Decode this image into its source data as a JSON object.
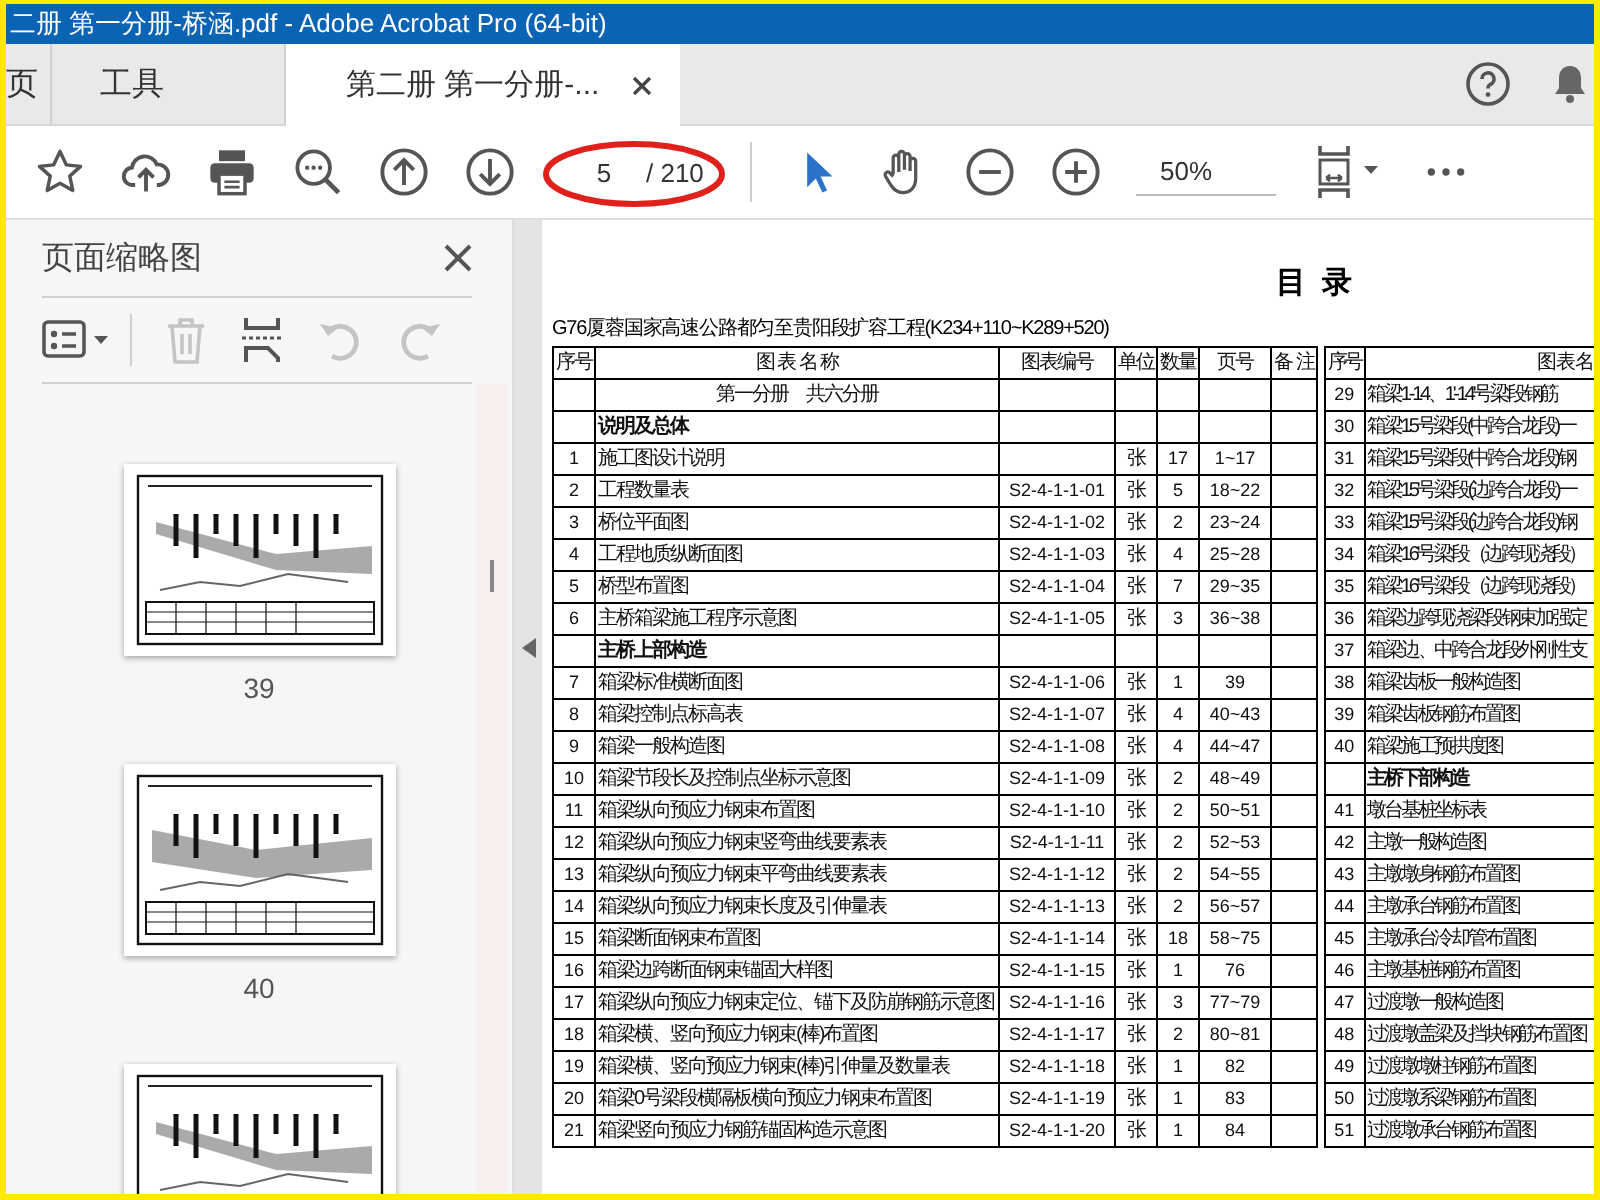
{
  "window": {
    "title": "二册 第一分册-桥涵.pdf - Adobe Acrobat Pro (64-bit)"
  },
  "tabs": [
    {
      "label": "页",
      "selected": false,
      "closable": false
    },
    {
      "label": "工具",
      "selected": false,
      "closable": false
    },
    {
      "label": "第二册 第一分册-...",
      "selected": true,
      "closable": true
    }
  ],
  "toolbar": {
    "page_number": "5",
    "page_count": "/ 210",
    "zoom": "50%"
  },
  "sidebar": {
    "title": "页面缩略图",
    "tools": [
      {
        "kind": "options",
        "disabled": false
      },
      {
        "kind": "delete",
        "disabled": true
      },
      {
        "kind": "insert",
        "disabled": false
      },
      {
        "kind": "rotate-left",
        "disabled": true
      },
      {
        "kind": "rotate-right",
        "disabled": true
      }
    ],
    "thumbnails": [
      {
        "kind": "page",
        "label": "39"
      },
      {
        "kind": "page",
        "label": "40"
      },
      {
        "kind": "page"
      }
    ]
  },
  "document": {
    "title": "目 录",
    "subtitle": "G76厦蓉国家高速公路都匀至贵阳段扩容工程(K234+110~K289+520)",
    "left_table": {
      "columns": [
        "序号",
        "图 表 名 称",
        "图表编号",
        "单位",
        "数量",
        "页号",
        "备 注"
      ],
      "rows": [
        {
          "kind": "volume",
          "name": "第一分册　共六分册"
        },
        {
          "kind": "section",
          "name": "说明及总体"
        },
        {
          "kind": "item",
          "no": "1",
          "name": "施工图设计说明",
          "unit": "张",
          "count": "17",
          "pages": "1~17"
        },
        {
          "kind": "item",
          "no": "2",
          "name": "工程数量表",
          "code": "S2-4-1-1-01",
          "unit": "张",
          "count": "5",
          "pages": "18~22"
        },
        {
          "kind": "item",
          "no": "3",
          "name": "桥位平面图",
          "code": "S2-4-1-1-02",
          "unit": "张",
          "count": "2",
          "pages": "23~24"
        },
        {
          "kind": "item",
          "no": "4",
          "name": "工程地质纵断面图",
          "code": "S2-4-1-1-03",
          "unit": "张",
          "count": "4",
          "pages": "25~28"
        },
        {
          "kind": "item",
          "no": "5",
          "name": "桥型布置图",
          "code": "S2-4-1-1-04",
          "unit": "张",
          "count": "7",
          "pages": "29~35"
        },
        {
          "kind": "item",
          "no": "6",
          "name": "主桥箱梁施工程序示意图",
          "code": "S2-4-1-1-05",
          "unit": "张",
          "count": "3",
          "pages": "36~38"
        },
        {
          "kind": "section",
          "name": "主桥上部构造"
        },
        {
          "kind": "item",
          "no": "7",
          "name": "箱梁标准横断面图",
          "code": "S2-4-1-1-06",
          "unit": "张",
          "count": "1",
          "pages": "39"
        },
        {
          "kind": "item",
          "no": "8",
          "name": "箱梁控制点标高表",
          "code": "S2-4-1-1-07",
          "unit": "张",
          "count": "4",
          "pages": "40~43"
        },
        {
          "kind": "item",
          "no": "9",
          "name": "箱梁一般构造图",
          "code": "S2-4-1-1-08",
          "unit": "张",
          "count": "4",
          "pages": "44~47"
        },
        {
          "kind": "item",
          "no": "10",
          "name": "箱梁节段长及控制点坐标示意图",
          "code": "S2-4-1-1-09",
          "unit": "张",
          "count": "2",
          "pages": "48~49"
        },
        {
          "kind": "item",
          "no": "11",
          "name": "箱梁纵向预应力钢束布置图",
          "code": "S2-4-1-1-10",
          "unit": "张",
          "count": "2",
          "pages": "50~51"
        },
        {
          "kind": "item",
          "no": "12",
          "name": "箱梁纵向预应力钢束竖弯曲线要素表",
          "code": "S2-4-1-1-11",
          "unit": "张",
          "count": "2",
          "pages": "52~53"
        },
        {
          "kind": "item",
          "no": "13",
          "name": "箱梁纵向预应力钢束平弯曲线要素表",
          "code": "S2-4-1-1-12",
          "unit": "张",
          "count": "2",
          "pages": "54~55"
        },
        {
          "kind": "item",
          "no": "14",
          "name": "箱梁纵向预应力钢束长度及引伸量表",
          "code": "S2-4-1-1-13",
          "unit": "张",
          "count": "2",
          "pages": "56~57"
        },
        {
          "kind": "item",
          "no": "15",
          "name": "箱梁断面钢束布置图",
          "code": "S2-4-1-1-14",
          "unit": "张",
          "count": "18",
          "pages": "58~75"
        },
        {
          "kind": "item",
          "no": "16",
          "name": "箱梁边跨断面钢束锚固大样图",
          "code": "S2-4-1-1-15",
          "unit": "张",
          "count": "1",
          "pages": "76"
        },
        {
          "kind": "item",
          "no": "17",
          "name": "箱梁纵向预应力钢束定位、锚下及防崩钢筋示意图",
          "code": "S2-4-1-1-16",
          "unit": "张",
          "count": "3",
          "pages": "77~79"
        },
        {
          "kind": "item",
          "no": "18",
          "name": "箱梁横、竖向预应力钢束(棒)布置图",
          "code": "S2-4-1-1-17",
          "unit": "张",
          "count": "2",
          "pages": "80~81"
        },
        {
          "kind": "item",
          "no": "19",
          "name": "箱梁横、竖向预应力钢束(棒)引伸量及数量表",
          "code": "S2-4-1-1-18",
          "unit": "张",
          "count": "1",
          "pages": "82"
        },
        {
          "kind": "item",
          "no": "20",
          "name": "箱梁0号梁段横隔板横向预应力钢束布置图",
          "code": "S2-4-1-1-19",
          "unit": "张",
          "count": "1",
          "pages": "83"
        },
        {
          "kind": "item",
          "no": "21",
          "name": "箱梁竖向预应力钢筋锚固构造示意图",
          "code": "S2-4-1-1-20",
          "unit": "张",
          "count": "1",
          "pages": "84"
        }
      ]
    },
    "right_table": {
      "columns": [
        "序号",
        "图 表 名"
      ],
      "rows": [
        {
          "kind": "item",
          "no": "29",
          "name": "箱梁1-14、1'-14'号梁段钢筋"
        },
        {
          "kind": "item",
          "no": "30",
          "name": "箱梁15号梁段(中跨合龙段)一"
        },
        {
          "kind": "item",
          "no": "31",
          "name": "箱梁15号梁段(中跨合龙段)钢"
        },
        {
          "kind": "item",
          "no": "32",
          "name": "箱梁15'号梁段(边跨合龙段)一"
        },
        {
          "kind": "item",
          "no": "33",
          "name": "箱梁15'号梁段(边跨合龙段)钢"
        },
        {
          "kind": "item",
          "no": "34",
          "name": "箱梁16'号梁段（边跨现浇段）"
        },
        {
          "kind": "item",
          "no": "35",
          "name": "箱梁16'号梁段（边跨现浇段）"
        },
        {
          "kind": "item",
          "no": "36",
          "name": "箱梁边跨现浇梁段钢束加强定"
        },
        {
          "kind": "item",
          "no": "37",
          "name": "箱梁边、中跨合龙段外刚性支"
        },
        {
          "kind": "item",
          "no": "38",
          "name": "箱梁齿板一般构造图"
        },
        {
          "kind": "item",
          "no": "39",
          "name": "箱梁齿板钢筋布置图"
        },
        {
          "kind": "item",
          "no": "40",
          "name": "箱梁施工预拱度图"
        },
        {
          "kind": "section",
          "name": "主桥下部构造"
        },
        {
          "kind": "item",
          "no": "41",
          "name": "墩台基桩坐标表"
        },
        {
          "kind": "item",
          "no": "42",
          "name": "主墩一般构造图"
        },
        {
          "kind": "item",
          "no": "43",
          "name": "主墩墩身钢筋布置图"
        },
        {
          "kind": "item",
          "no": "44",
          "name": "主墩承台钢筋布置图"
        },
        {
          "kind": "item",
          "no": "45",
          "name": "主墩承台冷却管布置图"
        },
        {
          "kind": "item",
          "no": "46",
          "name": "主墩基桩钢筋布置图"
        },
        {
          "kind": "item",
          "no": "47",
          "name": "过渡墩一般构造图"
        },
        {
          "kind": "item",
          "no": "48",
          "name": "过渡墩盖梁及挡块钢筋布置图"
        },
        {
          "kind": "item",
          "no": "49",
          "name": "过渡墩墩柱钢筋布置图"
        },
        {
          "kind": "item",
          "no": "50",
          "name": "过渡墩系梁钢筋布置图"
        },
        {
          "kind": "item",
          "no": "51",
          "name": "过渡墩承台钢筋布置图"
        }
      ]
    }
  }
}
